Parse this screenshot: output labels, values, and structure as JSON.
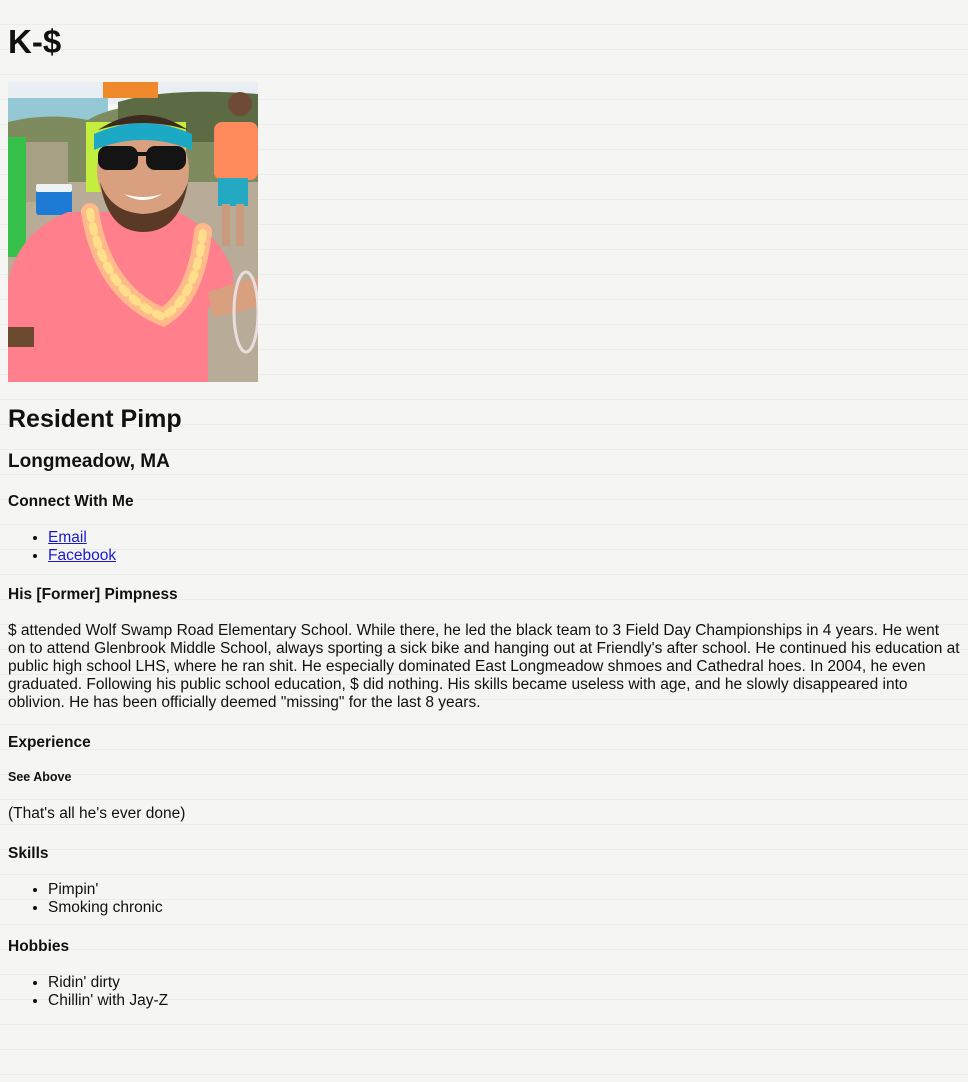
{
  "name": "K-$",
  "title": "Resident Pimp",
  "location": "Longmeadow, MA",
  "connect": {
    "heading": "Connect With Me",
    "links": [
      "Email",
      "Facebook"
    ]
  },
  "bio": {
    "heading": "His [Former] Pimpness",
    "text": "$ attended Wolf Swamp Road Elementary School. While there, he led the black team to 3 Field Day Championships in 4 years. He went on to attend Glenbrook Middle School, always sporting a sick bike and hanging out at Friendly's after school. He continued his education at public high school LHS, where he ran shit. He especially dominated East Longmeadow shmoes and Cathedral hoes. In 2004, he even graduated. Following his public school education, $ did nothing. His skills became useless with age, and he slowly disappeared into oblivion. He has been officially deemed \"missing\" for the last 8 years."
  },
  "experience": {
    "heading": "Experience",
    "subheading": "See Above",
    "text": "(That's all he's ever done)"
  },
  "skills": {
    "heading": "Skills",
    "items": [
      "Pimpin'",
      "Smoking chronic"
    ]
  },
  "hobbies": {
    "heading": "Hobbies",
    "items": [
      "Ridin' dirty",
      "Chillin' with Jay-Z"
    ]
  },
  "colors": {
    "link": "#1a1acc",
    "shirt": "#ff7f8c",
    "headband": "#1ba9c6",
    "sky": "#e7edf1",
    "sea": "#8fc9d6",
    "sand": "#b7a996"
  }
}
